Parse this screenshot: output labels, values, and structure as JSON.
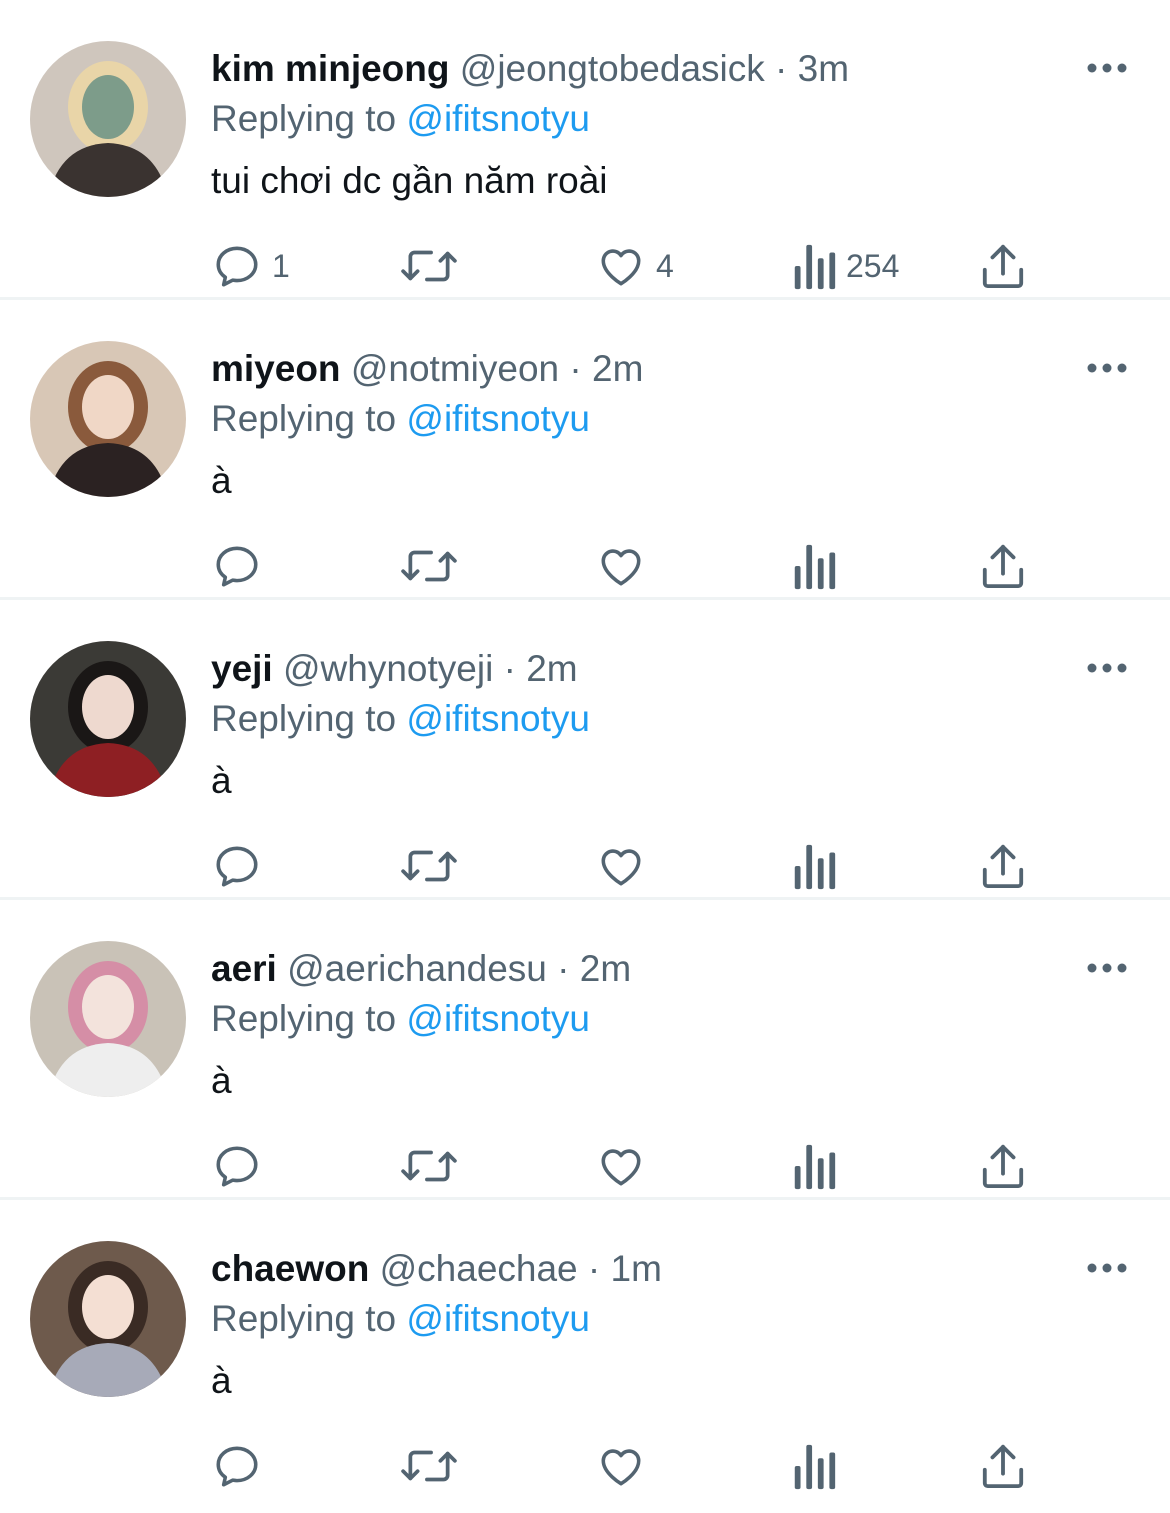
{
  "tweets": [
    {
      "name": "kim minjeong",
      "handle": "@jeongtobedasick",
      "time": "3m",
      "replying_prefix": "Replying to",
      "replying_to": "@ifitsnotyu",
      "text": "tui chơi dc gần năm roài",
      "reply_count": "1",
      "retweet_count": "",
      "like_count": "4",
      "view_count": "254",
      "avatar_colors": [
        "#cfc6bd",
        "#e9d5a8",
        "#7d9c8a",
        "#3a3330"
      ]
    },
    {
      "name": "miyeon",
      "handle": "@notmiyeon",
      "time": "2m",
      "replying_prefix": "Replying to",
      "replying_to": "@ifitsnotyu",
      "text": "à",
      "reply_count": "",
      "retweet_count": "",
      "like_count": "",
      "view_count": "",
      "avatar_colors": [
        "#d8c7b6",
        "#8a5a3c",
        "#f0d7c6",
        "#2b2222"
      ]
    },
    {
      "name": "yeji",
      "handle": "@whynotyeji",
      "time": "2m",
      "replying_prefix": "Replying to",
      "replying_to": "@ifitsnotyu",
      "text": "à",
      "reply_count": "",
      "retweet_count": "",
      "like_count": "",
      "view_count": "",
      "avatar_colors": [
        "#3b3a36",
        "#1a1716",
        "#eed9cf",
        "#8e1f23"
      ]
    },
    {
      "name": "aeri",
      "handle": "@aerichandesu",
      "time": "2m",
      "replying_prefix": "Replying to",
      "replying_to": "@ifitsnotyu",
      "text": "à",
      "reply_count": "",
      "retweet_count": "",
      "like_count": "",
      "view_count": "",
      "avatar_colors": [
        "#c9c2b7",
        "#d58ea6",
        "#f3e3dc",
        "#eeeeee"
      ]
    },
    {
      "name": "chaewon",
      "handle": "@chaechae",
      "time": "1m",
      "replying_prefix": "Replying to",
      "replying_to": "@ifitsnotyu",
      "text": "à",
      "reply_count": "",
      "retweet_count": "",
      "like_count": "",
      "view_count": "",
      "avatar_colors": [
        "#6e5a4c",
        "#3a2b24",
        "#f4dfd3",
        "#a7aab8"
      ]
    }
  ],
  "icons": {
    "reply": "chat-bubble-icon",
    "retweet": "retweet-icon",
    "like": "heart-icon",
    "views": "bar-chart-icon",
    "share": "share-icon",
    "more": "more-dots-icon"
  },
  "colors": {
    "text": "#0f1419",
    "secondary": "#536471",
    "link": "#1d9bf0",
    "divider": "#eff3f4"
  }
}
